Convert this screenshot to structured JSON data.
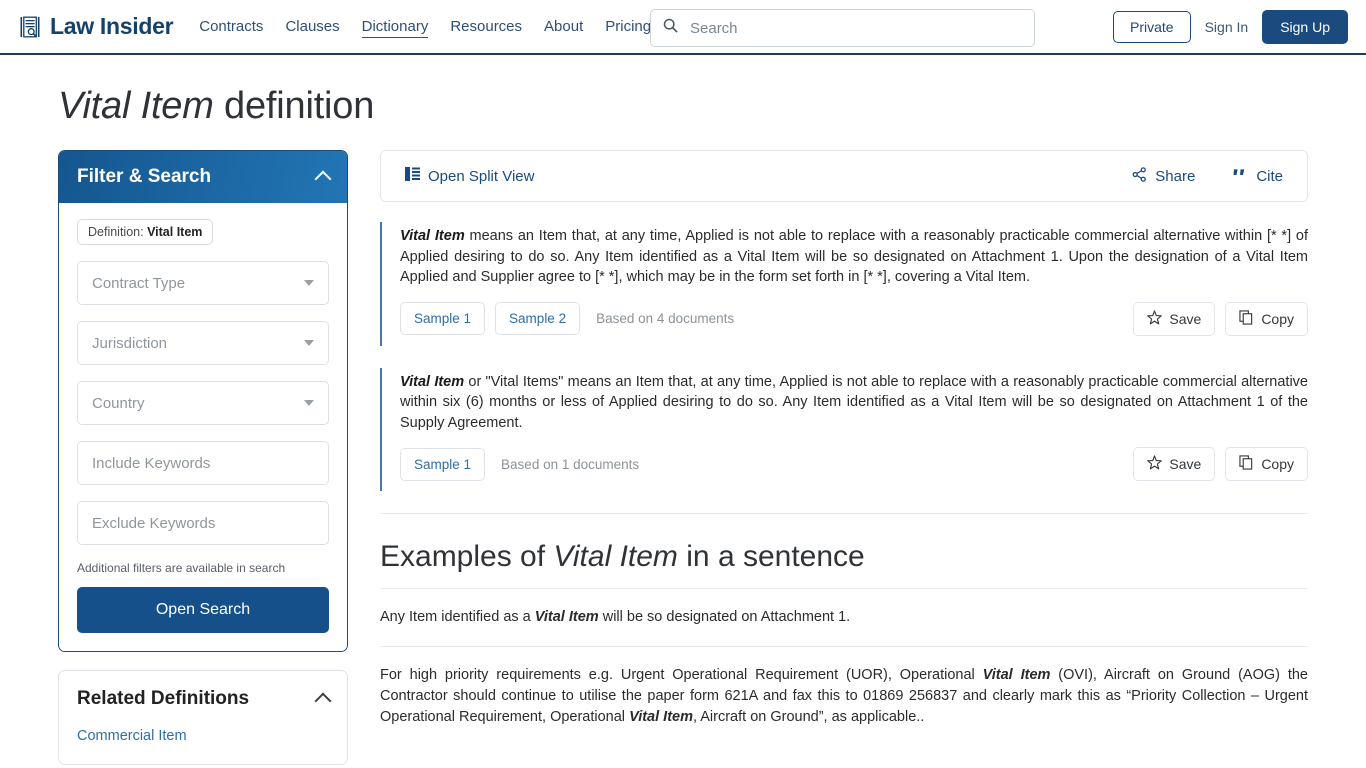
{
  "header": {
    "logo_text": "Law Insider",
    "logo_icon": "document-search-icon",
    "nav": [
      {
        "label": "Contracts",
        "active": false
      },
      {
        "label": "Clauses",
        "active": false
      },
      {
        "label": "Dictionary",
        "active": true
      },
      {
        "label": "Resources",
        "active": false
      },
      {
        "label": "About",
        "active": false
      },
      {
        "label": "Pricing",
        "active": false
      }
    ],
    "search_placeholder": "Search",
    "search_value": "",
    "private_label": "Private",
    "signin_label": "Sign In",
    "signup_label": "Sign Up"
  },
  "page": {
    "title_term": "Vital Item",
    "title_suffix": " definition"
  },
  "sidebar": {
    "filter": {
      "title": "Filter & Search",
      "chip_label": "Definition: ",
      "chip_value": "Vital Item",
      "fields": [
        {
          "placeholder": "Contract Type",
          "type": "select"
        },
        {
          "placeholder": "Jurisdiction",
          "type": "select"
        },
        {
          "placeholder": "Country",
          "type": "select"
        },
        {
          "placeholder": "Include Keywords",
          "type": "text"
        },
        {
          "placeholder": "Exclude Keywords",
          "type": "text"
        }
      ],
      "hint": "Additional filters are available in search",
      "open_search_label": "Open Search"
    },
    "related": {
      "title": "Related Definitions",
      "items": [
        {
          "label": "Commercial Item"
        }
      ]
    }
  },
  "main": {
    "toolbar": {
      "split_view_label": "Open Split View",
      "share_label": "Share",
      "cite_label": "Cite"
    },
    "definitions": [
      {
        "term": "Vital Item",
        "text": " means an Item that, at any time, Applied is not able to replace with a reasonably practicable commercial alternative within [* *] of Applied desiring to do so. Any Item identified as a Vital Item will be so designated on Attachment 1. Upon the designation of a Vital Item Applied and Supplier agree to [* *], which may be in the form set forth in [* *], covering a Vital Item.",
        "samples": [
          "Sample 1",
          "Sample 2"
        ],
        "based_on": "Based on 4 documents",
        "save_label": "Save",
        "copy_label": "Copy"
      },
      {
        "term": "Vital Item",
        "text": " or \"Vital Items\" means an Item that, at any time, Applied is not able to replace with a reasonably practicable commercial alternative within six (6) months or less of Applied desiring to do so. Any Item identified as a Vital Item will be so designated on Attachment 1 of the Supply Agreement.",
        "samples": [
          "Sample 1"
        ],
        "based_on": "Based on 1 documents",
        "save_label": "Save",
        "copy_label": "Copy"
      }
    ],
    "examples": {
      "title_prefix": "Examples of ",
      "title_term": "Vital Item",
      "title_suffix": " in a sentence",
      "items": [
        {
          "pre": "Any Item identified as a ",
          "term": "Vital Item",
          "post": " will be so designated on Attachment 1."
        },
        {
          "pre": "For high priority requirements e.g. Urgent Operational Requirement (UOR), Operational ",
          "term": "Vital Item",
          "mid": " (OVI), Aircraft on Ground (AOG) the Contractor should continue to utilise the paper form 621A and fax this to 01869 256837 and clearly mark this as “Priority Collection – Urgent Operational Requirement, Operational ",
          "term2": "Vital Item",
          "post": ", Aircraft on Ground”, as applicable.."
        }
      ]
    }
  },
  "colors": {
    "brand_blue": "#15426b",
    "accent_blue": "#1b4a7e",
    "link_blue": "#2f6ea5",
    "header_rule": "#1b3a5c"
  }
}
